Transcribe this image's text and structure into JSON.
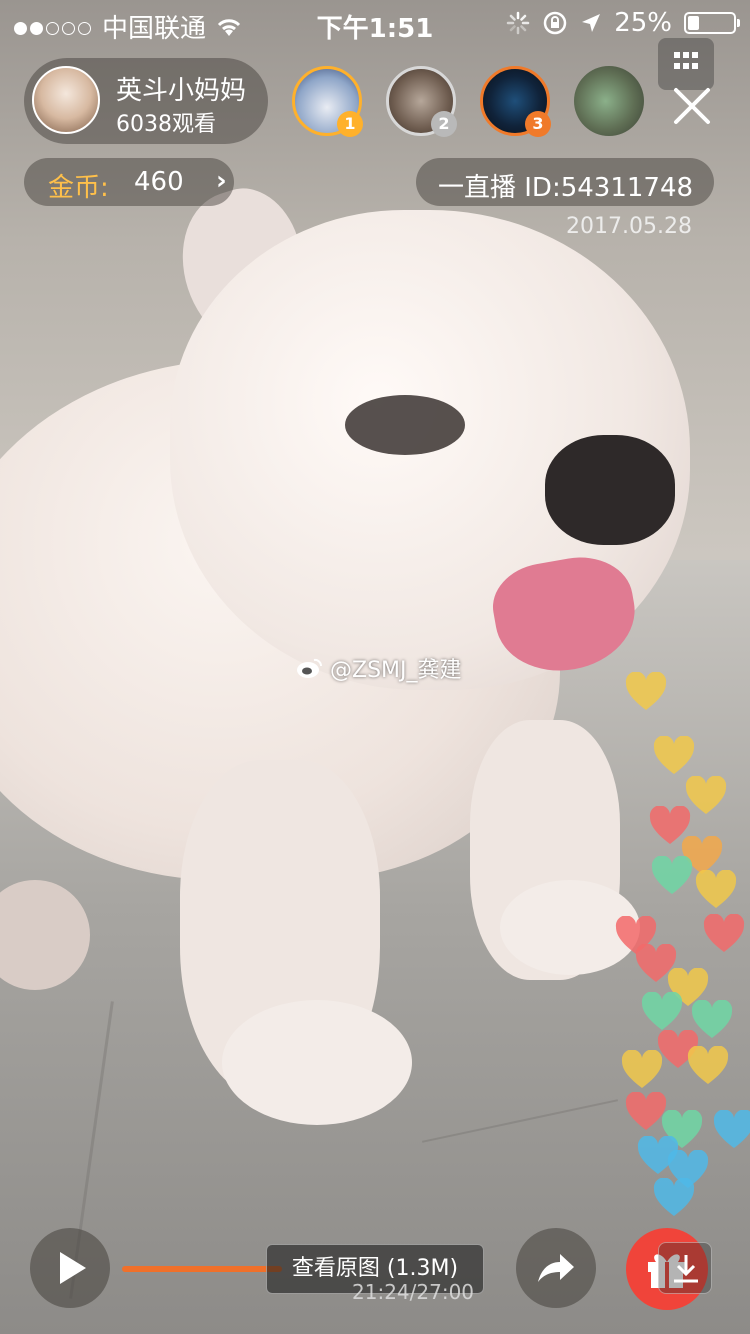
{
  "status_bar": {
    "carrier": "中国联通",
    "time": "下午1:51",
    "battery_percent": "25%",
    "battery_level": 0.25,
    "signal_dots_filled": 2,
    "signal_dots_total": 5
  },
  "host": {
    "name": "英斗小妈妈",
    "viewers": "6038观看"
  },
  "viewers_ranked": [
    {
      "rank": "1",
      "badge_color": "#ffb12b"
    },
    {
      "rank": "2",
      "badge_color": "#b9b9b9"
    },
    {
      "rank": "3",
      "badge_color": "#f07a2a"
    }
  ],
  "coins": {
    "label": "金币:",
    "value": "460",
    "chevron": "›"
  },
  "live": {
    "id_text": "一直播 ID:54311748",
    "date": "2017.05.28"
  },
  "watermark": {
    "text": "@ZSMJ_龚建",
    "icon": "weibo-icon"
  },
  "bottom": {
    "view_original": "查看原图 (1.3M)",
    "time_readout": "21:24/27:00"
  },
  "colors": {
    "accent_orange": "#f0702a",
    "coin_gold": "#ffc04a",
    "gift_red": "#f0443a"
  }
}
